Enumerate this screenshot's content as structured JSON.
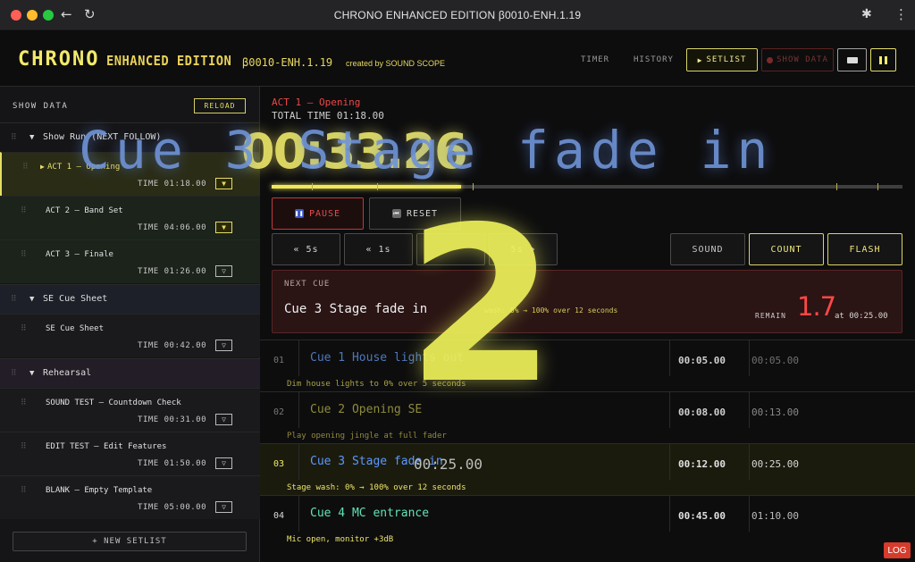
{
  "window": {
    "title": "CHRONO ENHANCED EDITION β0010-ENH.1.19"
  },
  "header": {
    "logo_main": "CHRONO",
    "logo_sub": "ENHANCED EDITION",
    "version": "β0010-ENH.1.19",
    "created_by": "created by SOUND SCOPE",
    "nav_timer": "TIMER",
    "nav_history": "HISTORY",
    "setlist_label": "SETLIST",
    "showdata_label": "SHOW DATA"
  },
  "sidebar": {
    "title": "SHOW DATA",
    "reload": "RELOAD",
    "groups": [
      {
        "name": "Show Run (NEXT FOLLOW)"
      },
      {
        "name": "SE Cue Sheet"
      },
      {
        "name": "Rehearsal"
      }
    ],
    "items": [
      {
        "name": "ACT 1 — Opening",
        "time": "TIME 01:18.00"
      },
      {
        "name": "ACT 2 — Band Set",
        "time": "TIME 04:06.00"
      },
      {
        "name": "ACT 3 — Finale",
        "time": "TIME 01:26.00"
      },
      {
        "name": "SE Cue Sheet",
        "time": "TIME 00:42.00"
      },
      {
        "name": "SOUND TEST — Countdown Check",
        "time": "TIME 00:31.00"
      },
      {
        "name": "EDIT TEST — Edit Features",
        "time": "TIME 01:50.00"
      },
      {
        "name": "BLANK — Empty Template",
        "time": "TIME 05:00.00"
      }
    ],
    "new_setlist": "+ NEW SETLIST"
  },
  "main": {
    "act_label": "ACT 1 — Opening",
    "total_time": "TOTAL TIME 01:18.00",
    "progress": 0.3,
    "pause": "PAUSE",
    "reset": "RESET",
    "skip": [
      "« 5s",
      "« 1s",
      "",
      "5s »"
    ],
    "sound": "SOUND",
    "count": "COUNT",
    "flash": "FLASH",
    "next": {
      "label": "NEXT CUE",
      "name": "Cue 3 Stage fade in",
      "desc": "wash: 0% → 100% over 12 seconds",
      "remain_label": "REMAIN",
      "remain_value": "1.7",
      "at_label": "at 00:25.00"
    },
    "cues": [
      {
        "num": "01",
        "name": "Cue 1 House lights out",
        "dur": "00:05.00",
        "at": "00:05.00",
        "desc": "Dim house lights to 0% over 5 seconds"
      },
      {
        "num": "02",
        "name": "Cue 2 Opening SE",
        "dur": "00:08.00",
        "at": "00:13.00",
        "desc": "Play opening jingle at full fader"
      },
      {
        "num": "03",
        "name": "Cue 3 Stage fade in",
        "dur": "00:12.00",
        "at": "00:25.00",
        "desc": "Stage wash: 0% → 100% over 12 seconds",
        "overlay": "00:25.00"
      },
      {
        "num": "04",
        "name": "Cue 4 MC entrance",
        "dur": "00:45.00",
        "at": "01:10.00",
        "desc": "Mic open, monitor +3dB"
      }
    ],
    "log": "LOG"
  },
  "overlay": {
    "cue_text": "Cue 3 Stage fade in",
    "timer_text": "00:33.26",
    "count_text": "2"
  },
  "colors": {
    "accent": "#f2e96b",
    "alert": "#e84848",
    "cue_blue": "#5d97ff",
    "cue_green": "#62e2b4"
  }
}
